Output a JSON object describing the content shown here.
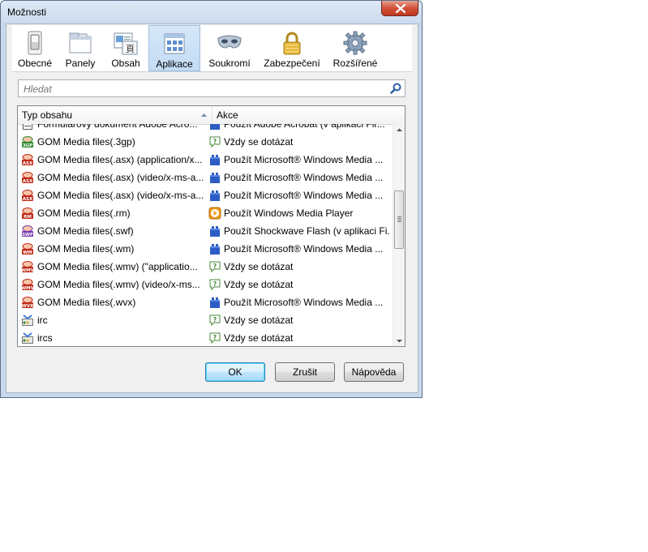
{
  "window": {
    "title": "Možnosti"
  },
  "toolbar": {
    "tabs": [
      {
        "label": "Obecné",
        "icon": "switch-icon"
      },
      {
        "label": "Panely",
        "icon": "tabs-icon"
      },
      {
        "label": "Obsah",
        "icon": "content-icon"
      },
      {
        "label": "Aplikace",
        "icon": "applications-icon",
        "active": true
      },
      {
        "label": "Soukromí",
        "icon": "privacy-mask-icon"
      },
      {
        "label": "Zabezpečení",
        "icon": "padlock-icon"
      },
      {
        "label": "Rozšířené",
        "icon": "gear-icon"
      }
    ]
  },
  "search": {
    "placeholder": "Hledat",
    "value": ""
  },
  "table": {
    "columns": [
      "Typ obsahu",
      "Akce"
    ],
    "sort": "ascending",
    "rows": [
      {
        "type": "Formulářový dokument Adobe Acro...",
        "type_icon": "form-doc-icon",
        "action": "Použít Adobe Acrobat (v aplikaci Fir...",
        "action_icon": "plugin-icon"
      },
      {
        "type": "GOM Media files(.3gp)",
        "type_icon": "gom-3gp-icon",
        "action": "Vždy se dotázat",
        "action_icon": "ask-icon"
      },
      {
        "type": "GOM Media files(.asx) (application/x...",
        "type_icon": "gom-asx-icon",
        "action": "Použít Microsoft® Windows Media ...",
        "action_icon": "plugin-icon"
      },
      {
        "type": "GOM Media files(.asx) (video/x-ms-a...",
        "type_icon": "gom-asx-icon",
        "action": "Použít Microsoft® Windows Media ...",
        "action_icon": "plugin-icon"
      },
      {
        "type": "GOM Media files(.asx) (video/x-ms-a...",
        "type_icon": "gom-asx-icon",
        "action": "Použít Microsoft® Windows Media ...",
        "action_icon": "plugin-icon"
      },
      {
        "type": "GOM Media files(.rm)",
        "type_icon": "gom-rm-icon",
        "action": "Použít Windows Media Player",
        "action_icon": "media-player-icon"
      },
      {
        "type": "GOM Media files(.swf)",
        "type_icon": "gom-swf-icon",
        "action": "Použít Shockwave Flash (v aplikaci Fi...",
        "action_icon": "plugin-icon"
      },
      {
        "type": "GOM Media files(.wm)",
        "type_icon": "gom-wm-icon",
        "action": "Použít Microsoft® Windows Media ...",
        "action_icon": "plugin-icon"
      },
      {
        "type": "GOM Media files(.wmv) (\"applicatio...",
        "type_icon": "gom-wmv-icon",
        "action": "Vždy se dotázat",
        "action_icon": "ask-icon"
      },
      {
        "type": "GOM Media files(.wmv) (video/x-ms...",
        "type_icon": "gom-wmv-icon",
        "action": "Vždy se dotázat",
        "action_icon": "ask-icon"
      },
      {
        "type": "GOM Media files(.wvx)",
        "type_icon": "gom-wvx-icon",
        "action": "Použít Microsoft® Windows Media ...",
        "action_icon": "plugin-icon"
      },
      {
        "type": "irc",
        "type_icon": "irc-icon",
        "action": "Vždy se dotázat",
        "action_icon": "ask-icon"
      },
      {
        "type": "ircs",
        "type_icon": "irc-icon",
        "action": "Vždy se dotázat",
        "action_icon": "ask-icon"
      }
    ],
    "scroll_position": 0.45
  },
  "buttons": {
    "ok": "OK",
    "cancel": "Zrušit",
    "help": "Nápověda"
  },
  "colors": {
    "active_tab": "#c2dbf4",
    "close_button": "#c1381f",
    "title_bar": "#c9d9ec"
  }
}
